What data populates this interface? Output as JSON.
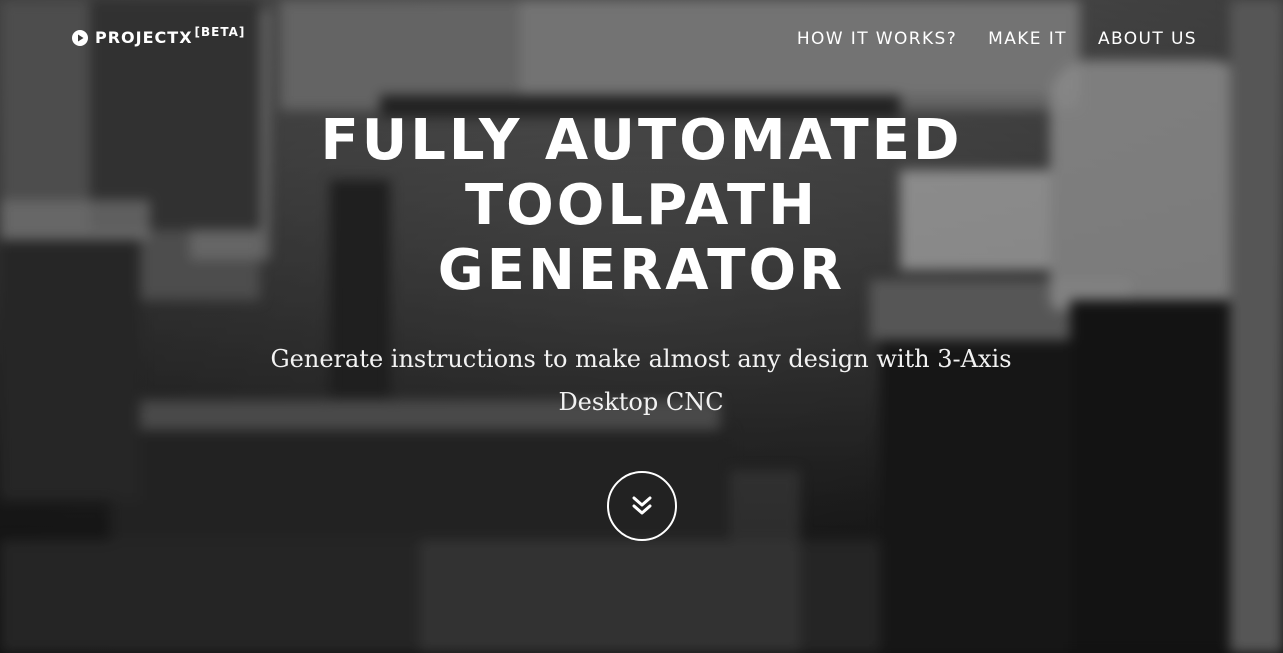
{
  "brand": {
    "name": "PROJECTX",
    "tag": "[BETA]",
    "icon": "play-circle-icon"
  },
  "nav": {
    "items": [
      {
        "label": "HOW IT WORKS?"
      },
      {
        "label": "MAKE IT"
      },
      {
        "label": "ABOUT US"
      }
    ]
  },
  "hero": {
    "headline_lines": [
      "FULLY AUTOMATED",
      "TOOLPATH",
      "GENERATOR"
    ],
    "subtitle": "Generate instructions to make almost any design with 3-Axis Desktop CNC",
    "scroll_icon": "double-chevron-down-icon"
  },
  "colors": {
    "text": "#ffffff",
    "background": "#3d3d3d"
  }
}
